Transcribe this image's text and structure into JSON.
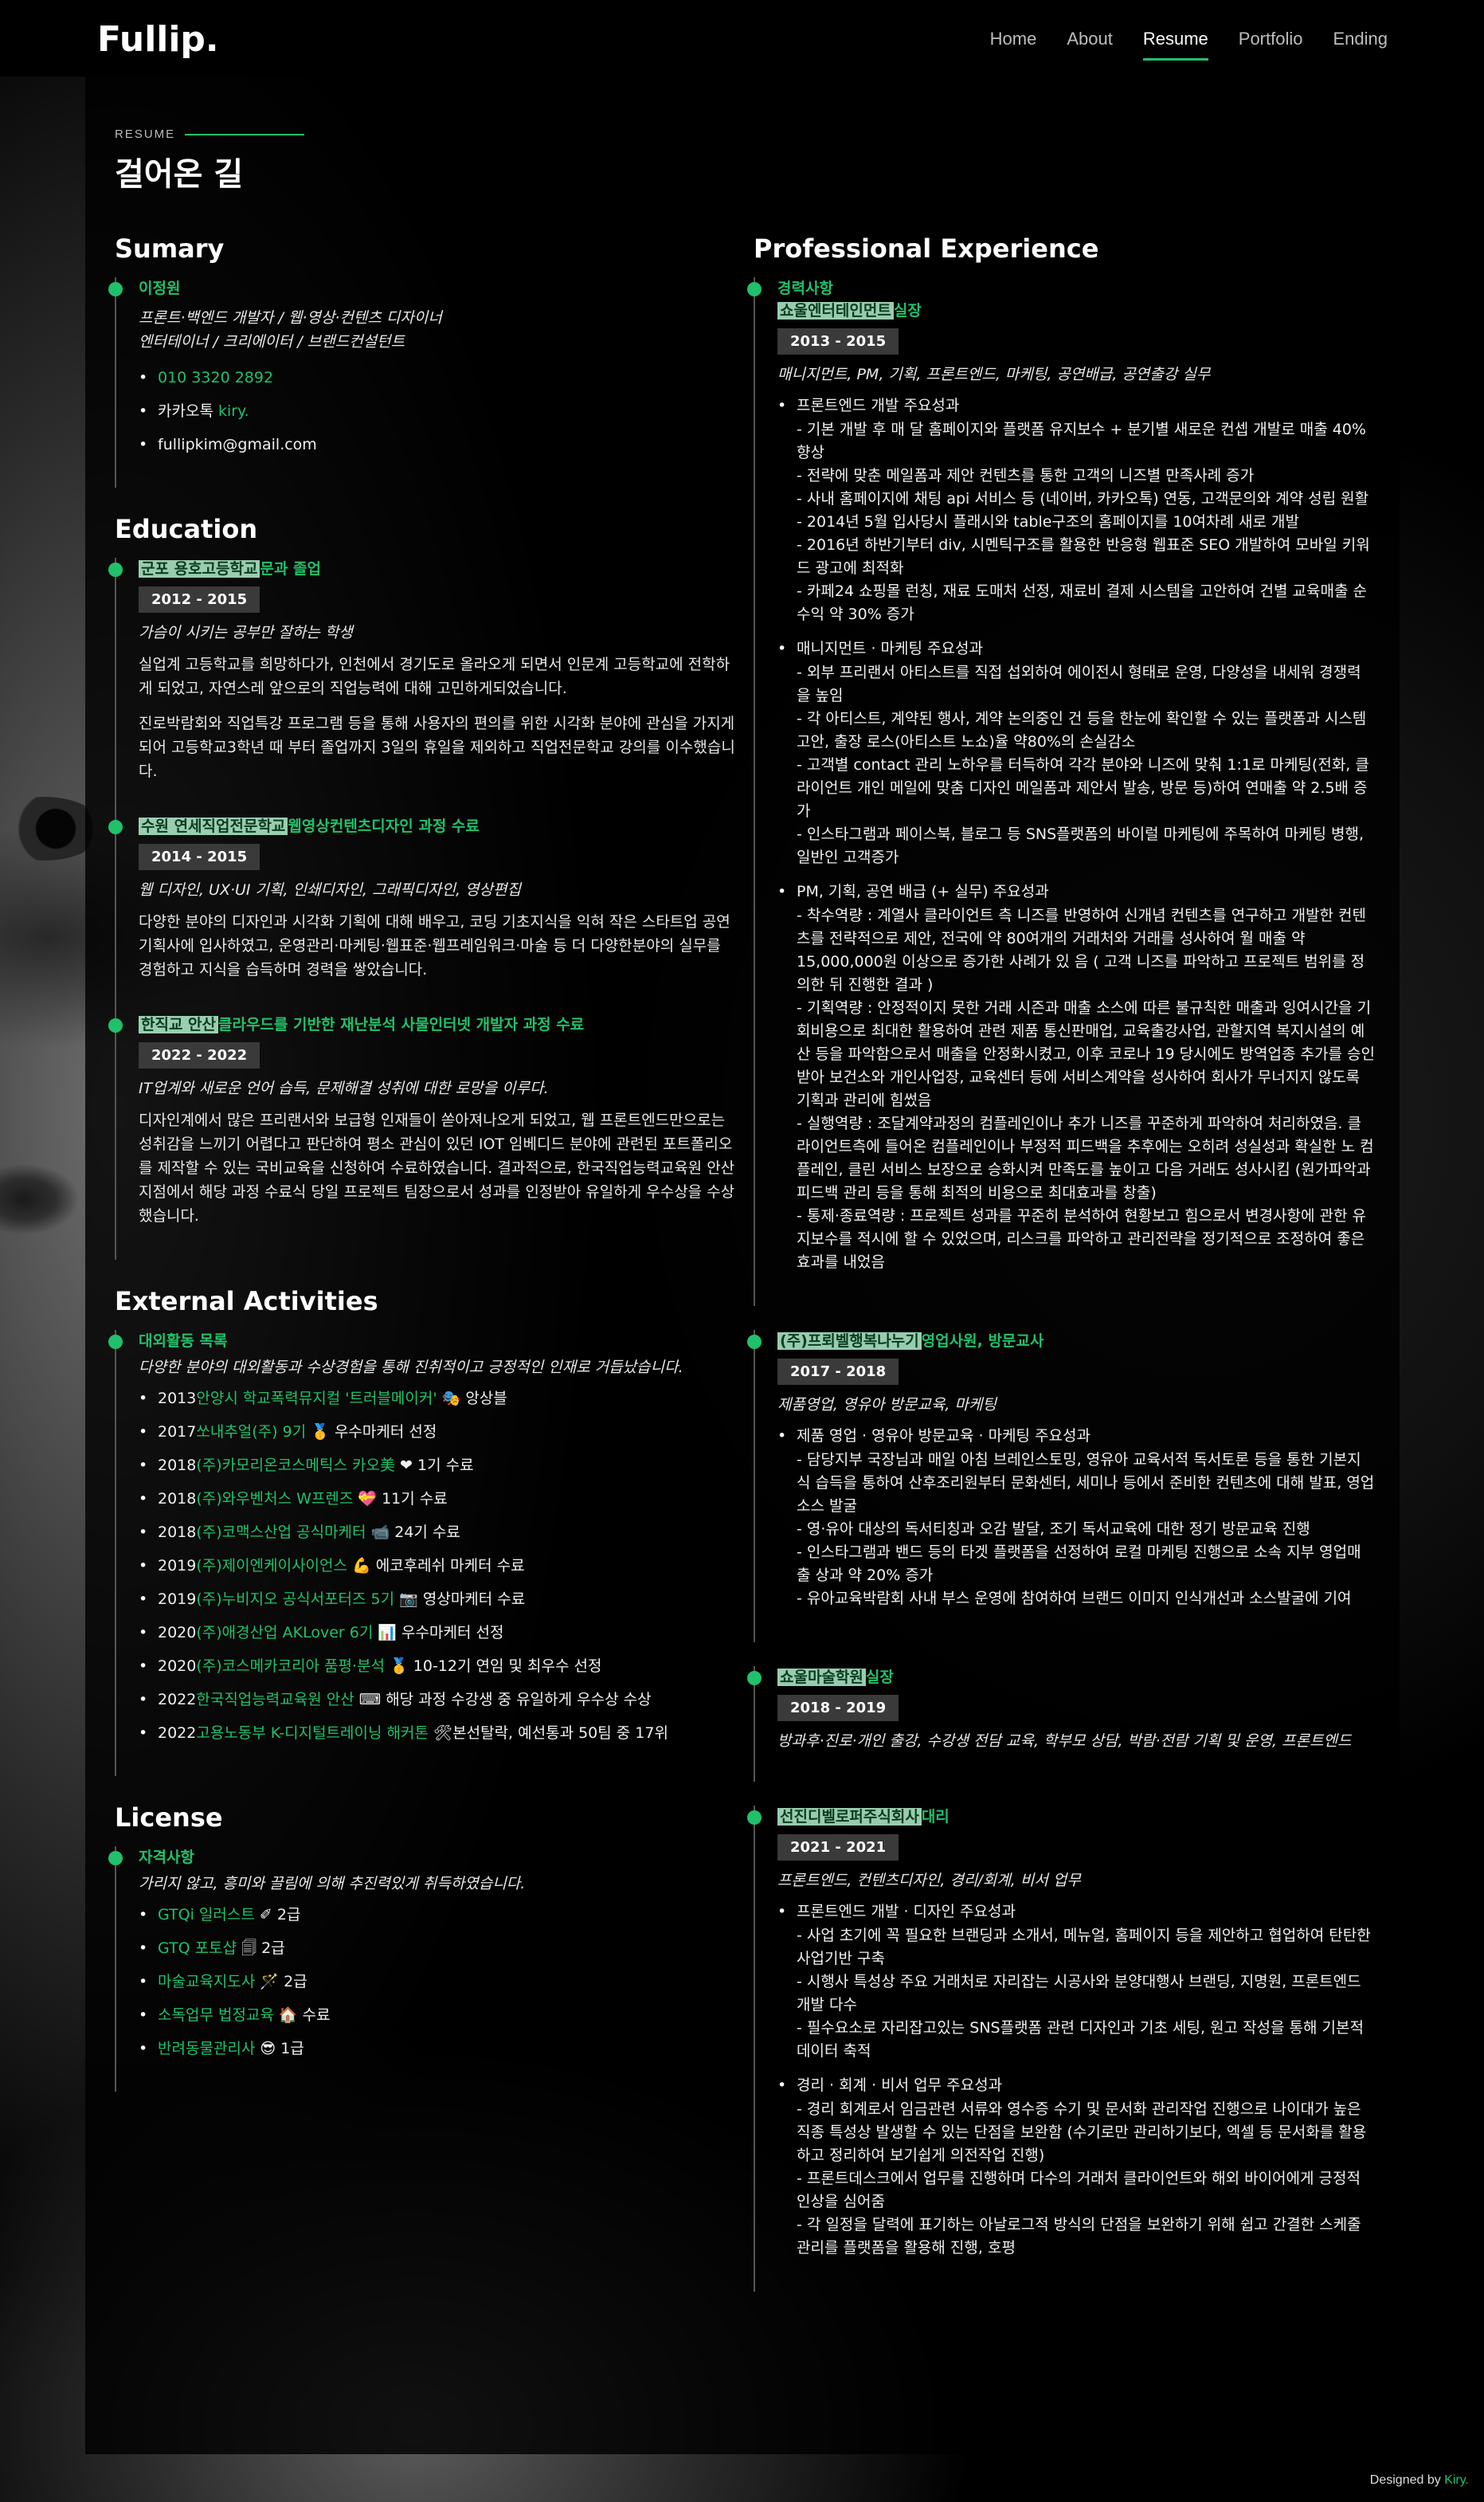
{
  "brand": "Fullip.",
  "nav": [
    "Home",
    "About",
    "Resume",
    "Portfolio",
    "Ending"
  ],
  "nav_active_index": 2,
  "eyebrow": "RESUME",
  "title": "걸어온 길",
  "accent_color": "#21c06a",
  "summary": {
    "heading": "Sumary",
    "name": "이정원",
    "role_lines": [
      "프론트·백엔드 개발자 / 웹·영상·컨텐츠 디자이너",
      "엔터테이너 / 크리에이터 / 브랜드컨설턴트"
    ],
    "contacts": [
      {
        "pre": "",
        "accent": "010 3320 2892",
        "post": ""
      },
      {
        "pre": "카카오톡 ",
        "accent": "kiry.",
        "post": ""
      },
      {
        "pre": "fullipkim@gmail.com",
        "accent": "",
        "post": ""
      }
    ]
  },
  "education": {
    "heading": "Education",
    "items": [
      {
        "title_hl": "군포 용호고등학교",
        "title_rest": "문과 졸업",
        "years": "2012 - 2015",
        "role": "가슴이 시키는 공부만 잘하는 학생",
        "paras": [
          "실업계 고등학교를 희망하다가, 인천에서 경기도로 올라오게 되면서 인문계 고등학교에 전학하게 되었고, 자연스레 앞으로의 직업능력에 대해 고민하게되었습니다.",
          "진로박람회와 직업특강 프로그램 등을 통해 사용자의 편의를 위한 시각화 분야에 관심을 가지게 되어 고등학교3학년 때 부터 졸업까지 3일의 휴일을 제외하고 직업전문학교 강의를 이수했습니다."
        ]
      },
      {
        "title_hl": "수원 연세직업전문학교",
        "title_rest": "웹영상컨텐츠디자인 과정 수료",
        "years": "2014 - 2015",
        "role": "웹 디자인, UX·UI 기획, 인쇄디자인, 그래픽디자인, 영상편집",
        "paras": [
          "다양한 분야의 디자인과 시각화 기획에 대해 배우고, 코딩 기초지식을 익혀 작은 스타트업 공연기획사에 입사하였고, 운영관리·마케팅·웹표준·웹프레임워크·마술 등 더 다양한분야의 실무를 경험하고 지식을 습득하며 경력을 쌓았습니다."
        ]
      },
      {
        "title_hl": "한직교 안산",
        "title_rest": "클라우드를 기반한 재난분석 사물인터넷 개발자 과정 수료",
        "years": "2022 - 2022",
        "role": "IT업계와 새로운 언어 습득, 문제해결 성취에 대한 로망을 이루다.",
        "paras": [
          "디자인계에서 많은 프리랜서와 보급형 인재들이 쏟아져나오게 되었고, 웹 프론트엔드만으로는 성취감을 느끼기 어렵다고 판단하여 평소 관심이 있던 IOT 임베디드 분야에 관련된 포트폴리오를 제작할 수 있는 국비교육을 신청하여 수료하였습니다. 결과적으로, 한국직업능력교육원 안산지점에서 해당 과정 수료식 당일 프로젝트 팀장으로서 성과를 인정받아 유일하게 우수상을 수상했습니다."
        ]
      }
    ]
  },
  "external": {
    "heading": "External Activities",
    "title": "대외활동 목록",
    "role": "다양한 분야의 대외활동과 수상경험을 통해 진취적이고 긍정적인 인재로 거듭났습니다.",
    "items": [
      {
        "pre": "2013",
        "accent": "안양시 학교폭력뮤지컬 '트러블메이커'",
        "post": "🎭 앙상블"
      },
      {
        "pre": "2017",
        "accent": "쏘내추얼(주) 9기",
        "post": "🥇 우수마케터 선정"
      },
      {
        "pre": "2018",
        "accent": "(주)카모리온코스메틱스 카오美",
        "post": "❤ 1기 수료"
      },
      {
        "pre": "2018",
        "accent": "(주)와우벤처스 W프렌즈",
        "post": "💝 11기 수료"
      },
      {
        "pre": "2018",
        "accent": "(주)코맥스산업 공식마케터",
        "post": "📹 24기 수료"
      },
      {
        "pre": "2019",
        "accent": "(주)제이엔케이사이언스",
        "post": "💪 에코후레쉬 마케터 수료"
      },
      {
        "pre": "2019",
        "accent": "(주)누비지오 공식서포터즈 5기",
        "post": "📷 영상마케터 수료"
      },
      {
        "pre": "2020",
        "accent": "(주)애경산업 AKLover 6기",
        "post": "📊 우수마케터 선정"
      },
      {
        "pre": "2020",
        "accent": "(주)코스메카코리아 품평·분석",
        "post": "🥇 10-12기 연임 및 최우수 선정"
      },
      {
        "pre": "2022",
        "accent": "한국직업능력교육원 안산",
        "post": "⌨ 해당 과정 수강생 중 유일하게 우수상 수상"
      },
      {
        "pre": "2022",
        "accent": "고용노동부 K-디지털트레이닝 해커톤",
        "post": "🛠본선탈락, 예선통과 50팀 중 17위"
      }
    ]
  },
  "license": {
    "heading": "License",
    "title": "자격사항",
    "role": "가리지 않고, 흥미와 끌림에 의해 추진력있게 취득하였습니다.",
    "items": [
      {
        "accent": "GTQi 일러스트",
        "post": "✐ 2급"
      },
      {
        "accent": "GTQ 포토샵",
        "post": "🗐 2급"
      },
      {
        "accent": "마술교육지도사",
        "post": "🪄 2급"
      },
      {
        "accent": "소독업무 법정교육",
        "post": "🏠 수료"
      },
      {
        "accent": "반려동물관리사",
        "post": "😎 1급"
      }
    ]
  },
  "experience": {
    "heading": "Professional Experience",
    "section_title": "경력사항",
    "jobs": [
      {
        "title_hl": "쇼울엔터테인먼트",
        "title_rest": "실장",
        "years": "2013 - 2015",
        "role": "매니지먼트, PM, 기획, 프론트엔드, 마케팅, 공연배급, 공연출강 실무",
        "blocks": [
          {
            "head": "프론트엔드 개발 주요성과",
            "lines": [
              "- 기본 개발 후 매 달 홈페이지와 플랫폼 유지보수 + 분기별 새로운 컨셉 개발로 매출 40% 향상",
              "- 전략에 맞춘 메일폼과 제안 컨텐츠를 통한 고객의 니즈별 만족사례 증가",
              "- 사내 홈페이지에 채팅 api 서비스 등 (네이버, 카카오톡) 연동, 고객문의와 계약 성립 원활",
              "- 2014년 5월 입사당시 플래시와 table구조의 홈페이지를 10여차례 새로 개발",
              "- 2016년 하반기부터 div, 시멘틱구조를 활용한 반응형 웹표준 SEO 개발하여 모바일 키워드 광고에 최적화",
              "- 카페24 쇼핑몰 런칭, 재료 도매처 선정, 재료비 결제 시스템을 고안하여 건별 교육매출 순수익 약 30% 증가"
            ]
          },
          {
            "head": "매니지먼트 · 마케팅 주요성과",
            "lines": [
              "- 외부 프리랜서 아티스트를 직접 섭외하여 에이전시 형태로 운영, 다양성을 내세워 경쟁력을 높임",
              "- 각 아티스트, 계약된 행사, 계약 논의중인 건 등을 한눈에 확인할 수 있는 플랫폼과 시스템 고안, 출장 로스(아티스트 노쇼)율 약80%의 손실감소",
              "- 고객별 contact 관리 노하우를 터득하여 각각 분야와 니즈에 맞춰 1:1로 마케팅(전화, 클라이언트 개인 메일에 맞춤 디자인 메일폼과 제안서 발송, 방문 등)하여 연매출 약 2.5배 증가",
              "- 인스타그램과 페이스북, 블로그 등 SNS플랫폼의 바이럴 마케팅에 주목하여 마케팅 병행, 일반인 고객증가"
            ]
          },
          {
            "head": "PM, 기획, 공연 배급 (+ 실무) 주요성과",
            "lines": [
              "- 착수역량 : 계열사 클라이언트 측 니즈를 반영하여 신개념 컨텐츠를 연구하고 개발한 컨텐츠를 전략적으로 제안, 전국에 약 80여개의 거래처와 거래를 성사하여 월 매출 약 15,000,000원 이상으로 증가한 사례가 있 음 ( 고객 니즈를 파악하고 프로젝트 범위를 정의한 뒤 진행한 결과 )",
              "- 기획역량 : 안정적이지 못한 거래 시즌과 매출 소스에 따른 불규칙한 매출과 잉여시간을 기회비용으로 최대한 활용하여 관련 제품 통신판매업, 교육출강사업, 관할지역 복지시설의 예산 등을 파악함으로서 매출을 안정화시켰고, 이후 코로나 19 당시에도 방역업종 추가를 승인받아 보건소와 개인사업장, 교육센터 등에 서비스계약을 성사하여 회사가 무너지지 않도록 기획과 관리에 힘썼음",
              "- 실행역량 : 조달계약과정의 컴플레인이나 추가 니즈를 꾸준하게 파악하여 처리하였음. 클라이언트측에 들어온 컴플레인이나 부정적 피드백을 추후에는 오히려 성실성과 확실한 노 컴플레인, 클린 서비스 보장으로 승화시켜 만족도를 높이고 다음 거래도 성사시킴 (원가파악과 피드백 관리 등을 통해 최적의 비용으로 최대효과를 창출)",
              "- 통제·종료역량 : 프로젝트 성과를 꾸준히 분석하여 현황보고 힘으로서 변경사항에 관한 유지보수를 적시에 할 수 있었으며, 리스크를 파악하고 관리전략을 정기적으로 조정하여 좋은 효과를 내었음"
            ]
          }
        ]
      },
      {
        "title_hl": "(주)프뢰벨행복나누기",
        "title_rest": "영업사원, 방문교사",
        "years": "2017 - 2018",
        "role": "제품영업, 영유아 방문교육, 마케팅",
        "blocks": [
          {
            "head": "제품 영업 · 영유아 방문교육 · 마케팅 주요성과",
            "lines": [
              "- 담당지부 국장님과 매일 아침 브레인스토밍, 영유아 교육서적 독서토론 등을 통한 기본지식 습득을 통하여 산후조리원부터 문화센터, 세미나 등에서 준비한 컨텐츠에 대해 발표, 영업 소스 발굴",
              "- 영·유아 대상의 독서티칭과 오감 발달, 조기 독서교육에 대한 정기 방문교육 진행",
              "- 인스타그램과 밴드 등의 타겟 플랫폼을 선정하여 로컬 마케팅 진행으로 소속 지부 영업매출 상과 약 20% 증가",
              "- 유아교육박람회 사내 부스 운영에 참여하여 브랜드 이미지 인식개선과 소스발굴에 기여"
            ]
          }
        ]
      },
      {
        "title_hl": "쇼울마술학원",
        "title_rest": "실장",
        "years": "2018 - 2019",
        "role": "방과후·진로·개인 출강, 수강생 전담 교육, 학부모 상담, 박람·전람 기획 및 운영, 프론트엔드",
        "blocks": []
      },
      {
        "title_hl": "선진디벨로퍼주식회사",
        "title_rest": "대리",
        "years": "2021 - 2021",
        "role": "프론트엔드, 컨텐츠디자인, 경리/회계, 비서 업무",
        "blocks": [
          {
            "head": "프론트엔드 개발 · 디자인 주요성과",
            "lines": [
              "- 사업 초기에 꼭 필요한 브랜딩과 소개서, 메뉴얼, 홈페이지 등을 제안하고 협업하여 탄탄한 사업기반 구축",
              "- 시행사 특성상 주요 거래처로 자리잡는 시공사와 분양대행사 브랜딩, 지명원, 프론트엔드 개발 다수",
              "- 필수요소로 자리잡고있는 SNS플랫폼 관련 디자인과 기초 세팅, 원고 작성을 통해 기본적 데이터 축적"
            ]
          },
          {
            "head": "경리 · 회계 · 비서 업무 주요성과",
            "lines": [
              "- 경리 회계로서 임금관련 서류와 영수증 수기 및 문서화 관리작업 진행으로 나이대가 높은 직종 특성상 발생할 수 있는 단점을 보완함 (수기로만 관리하기보다, 엑셀 등 문서화를 활용하고 정리하여 보기쉽게 의전작업 진행)",
              "- 프론트데스크에서 업무를 진행하며 다수의 거래처 클라이언트와 해외 바이어에게 긍정적 인상을 심어줌",
              "- 각 일정을 달력에 표기하는 아날로그적 방식의 단점을 보완하기 위해 쉽고 간결한 스케줄 관리를 플랫폼을 활용해 진행, 호평"
            ]
          }
        ]
      }
    ]
  },
  "footer": {
    "pre": "Designed by ",
    "accent": "Kiry."
  }
}
